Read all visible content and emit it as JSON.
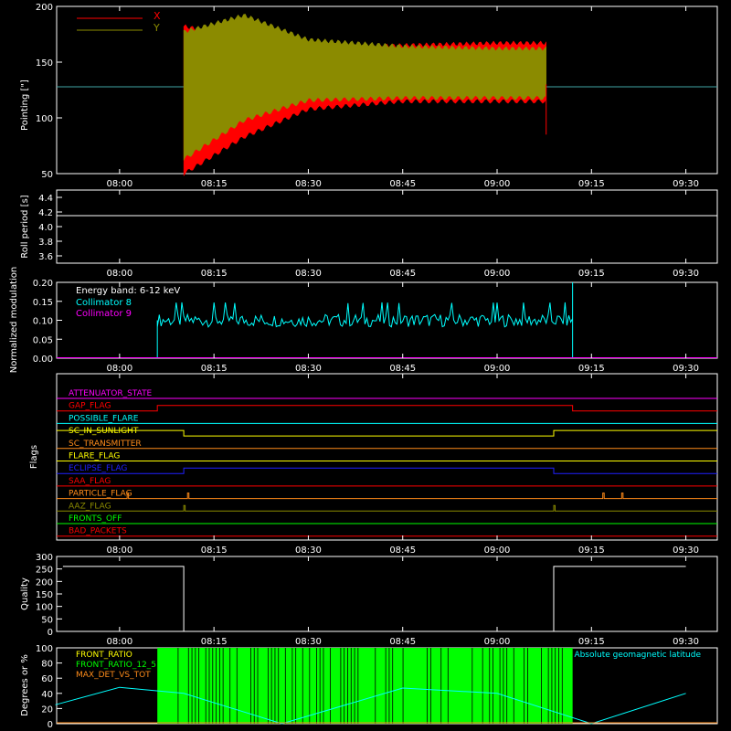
{
  "time_ticks": [
    "08:00",
    "08:15",
    "08:30",
    "08:45",
    "09:00",
    "09:15",
    "09:30"
  ],
  "colors": {
    "frame": "#ffffff",
    "x_series": "#ff0000",
    "y_series": "#8b8b00",
    "collimator8": "#00ffff",
    "collimator9": "#ff00ff",
    "green": "#00ff00",
    "orange": "#ff8c1a"
  },
  "chart_data": [
    {
      "type": "line",
      "ylabel": "Pointing [\"]",
      "ylim": [
        50,
        200
      ],
      "yticks": [
        "200",
        "150",
        "100",
        "50"
      ],
      "legend": [
        "X",
        "Y"
      ],
      "legend_position": "top-left",
      "reference_line": 128,
      "series": [
        {
          "name": "X",
          "color": "#ff0000",
          "upper": [
            [
              8.17,
              180
            ],
            [
              8.33,
              170
            ],
            [
              8.5,
              160
            ],
            [
              8.75,
              163
            ],
            [
              9.0,
              165
            ],
            [
              9.13,
              165
            ]
          ],
          "lower": [
            [
              8.17,
              52
            ],
            [
              8.33,
              85
            ],
            [
              8.5,
              110
            ],
            [
              8.75,
              117
            ],
            [
              9.0,
              117
            ],
            [
              9.13,
              117
            ]
          ]
        },
        {
          "name": "Y",
          "color": "#8b8b00",
          "upper": [
            [
              8.17,
              175
            ],
            [
              8.33,
              190
            ],
            [
              8.5,
              168
            ],
            [
              8.75,
              162
            ],
            [
              9.0,
              160
            ],
            [
              9.13,
              160
            ]
          ],
          "lower": [
            [
              8.17,
              65
            ],
            [
              8.33,
              100
            ],
            [
              8.5,
              118
            ],
            [
              8.75,
              120
            ],
            [
              9.0,
              120
            ],
            [
              9.13,
              120
            ]
          ]
        }
      ]
    },
    {
      "type": "line",
      "ylabel": "Roll period [s]",
      "ylim": [
        3.5,
        4.5
      ],
      "yticks": [
        "4.4",
        "4.2",
        "4.0",
        "3.8",
        "3.6"
      ],
      "value": 4.15
    },
    {
      "type": "line",
      "ylabel": "Normalized modulation",
      "ylim": [
        0,
        0.2
      ],
      "yticks": [
        "0.20",
        "0.15",
        "0.10",
        "0.05",
        "0.00"
      ],
      "annotation": "Energy band: 6-12 keV",
      "series": [
        {
          "name": "Collimator 8",
          "color": "#00ffff",
          "start": 8.1,
          "end": 9.2,
          "mean": 0.1,
          "range": [
            0.07,
            0.165
          ]
        },
        {
          "name": "Collimator 9",
          "color": "#ff00ff",
          "value": 0.0
        }
      ]
    },
    {
      "type": "line",
      "ylabel": "Flags",
      "flags": [
        {
          "name": "ATTENUATOR_STATE",
          "color": "#ff00ff",
          "steps": []
        },
        {
          "name": "GAP_FLAG",
          "color": "#ff0000",
          "steps": [
            [
              8.1,
              1
            ],
            [
              9.2,
              0
            ]
          ]
        },
        {
          "name": "POSSIBLE_FLARE",
          "color": "#00ffff",
          "steps": []
        },
        {
          "name": "SC_IN_SUNLIGHT",
          "color": "#ffff00",
          "steps": [
            [
              8.17,
              0
            ],
            [
              9.15,
              1
            ]
          ]
        },
        {
          "name": "SC_TRANSMITTER",
          "color": "#ff8c1a",
          "steps": []
        },
        {
          "name": "FLARE_FLAG",
          "color": "#ffff00",
          "steps": []
        },
        {
          "name": "ECLIPSE_FLAG",
          "color": "#2020ff",
          "steps": [
            [
              8.17,
              1
            ],
            [
              9.15,
              0
            ]
          ]
        },
        {
          "name": "SAA_FLAG",
          "color": "#ff0000",
          "steps": []
        },
        {
          "name": "PARTICLE_FLAG",
          "color": "#ff8c1a",
          "pulses": [
            8.02,
            8.18,
            9.28,
            9.33
          ]
        },
        {
          "name": "AAZ_FLAG",
          "color": "#8b8b00",
          "pulses": [
            8.17,
            9.15
          ]
        },
        {
          "name": "FRONTS_OFF",
          "color": "#00ff00",
          "steps": []
        },
        {
          "name": "BAD_PACKETS",
          "color": "#ff0000",
          "steps": []
        }
      ]
    },
    {
      "type": "line",
      "ylabel": "Quality",
      "ylim": [
        0,
        300
      ],
      "yticks": [
        "300",
        "250",
        "200",
        "150",
        "100",
        "50",
        "0"
      ],
      "steps": [
        [
          7.85,
          260
        ],
        [
          8.17,
          0
        ],
        [
          9.15,
          260
        ],
        [
          9.5,
          260
        ]
      ]
    },
    {
      "type": "line",
      "ylabel": "Degrees or %",
      "ylim": [
        0,
        100
      ],
      "yticks": [
        "100",
        "80",
        "60",
        "40",
        "20",
        "0"
      ],
      "legend": [
        "FRONT_RATIO",
        "FRONT_RATIO_12_5",
        "MAX_DET_VS_TOT"
      ],
      "annotation": "Absolute geomagnetic latitude",
      "green_block": [
        8.1,
        9.2
      ],
      "latitude": [
        [
          7.83,
          25
        ],
        [
          8.0,
          48
        ],
        [
          8.17,
          40
        ],
        [
          8.43,
          0
        ],
        [
          8.75,
          47
        ],
        [
          9.0,
          40
        ],
        [
          9.25,
          0
        ],
        [
          9.5,
          40
        ]
      ]
    }
  ]
}
